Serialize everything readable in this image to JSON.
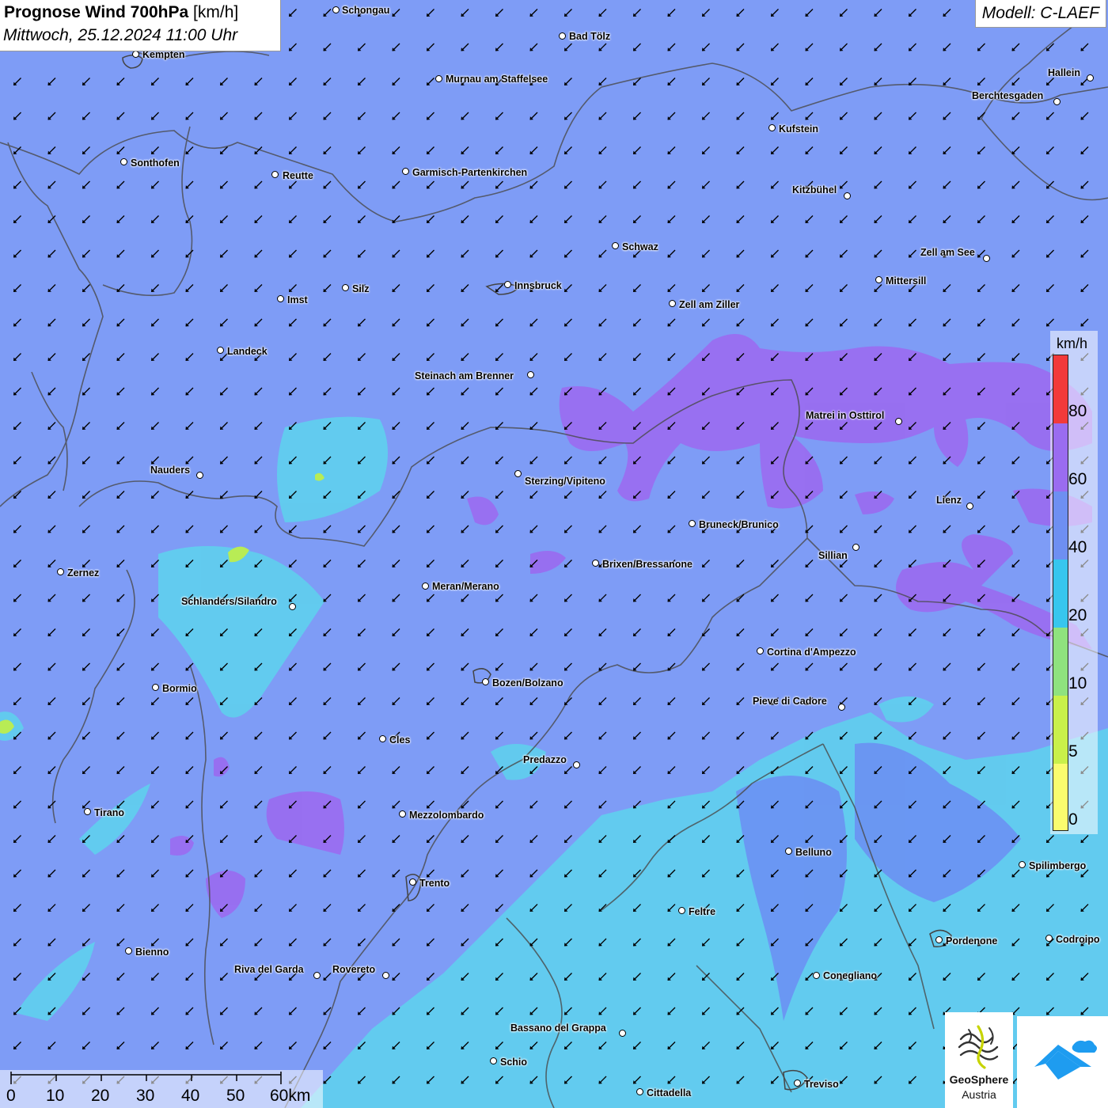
{
  "header": {
    "title": "Prognose Wind 700hPa",
    "title_unit": "[km/h]",
    "datetime": "Mittwoch, 25.12.2024 11:00 Uhr"
  },
  "model_label": "Modell: C-LAEF",
  "colors": {
    "background_wind": "#7e9cf6",
    "wind_20_40": "#5fd0ee",
    "wind_60_80": "#9a6cf0",
    "border_line": "#4a4a4a",
    "arrow_color": "#000000"
  },
  "wind_direction": "from northeast (arrows pointing southwest)",
  "cities": [
    {
      "name": "Schongau"
    },
    {
      "name": "Bad Tölz"
    },
    {
      "name": "Kempten"
    },
    {
      "name": "Murnau am Staffelsee"
    },
    {
      "name": "Hallein"
    },
    {
      "name": "Berchtesgaden"
    },
    {
      "name": "Kufstein"
    },
    {
      "name": "Sonthofen"
    },
    {
      "name": "Reutte"
    },
    {
      "name": "Garmisch-Partenkirchen"
    },
    {
      "name": "Kitzbühel"
    },
    {
      "name": "Schwaz"
    },
    {
      "name": "Zell am See"
    },
    {
      "name": "Mittersill"
    },
    {
      "name": "Innsbruck"
    },
    {
      "name": "Silz"
    },
    {
      "name": "Imst"
    },
    {
      "name": "Zell am Ziller"
    },
    {
      "name": "Landeck"
    },
    {
      "name": "Steinach am Brenner"
    },
    {
      "name": "Matrei in Osttirol"
    },
    {
      "name": "Nauders"
    },
    {
      "name": "Sterzing/Vipiteno"
    },
    {
      "name": "Lienz"
    },
    {
      "name": "Bruneck/Brunico"
    },
    {
      "name": "Sillian"
    },
    {
      "name": "Zernez"
    },
    {
      "name": "Brixen/Bressanone"
    },
    {
      "name": "Meran/Merano"
    },
    {
      "name": "Schlanders/Silandro"
    },
    {
      "name": "Cortina d'Ampezzo"
    },
    {
      "name": "Bozen/Bolzano"
    },
    {
      "name": "Bormio"
    },
    {
      "name": "Pieve di Cadore"
    },
    {
      "name": "Cles"
    },
    {
      "name": "Predazzo"
    },
    {
      "name": "Tirano"
    },
    {
      "name": "Mezzolombardo"
    },
    {
      "name": "Belluno"
    },
    {
      "name": "Spilimbergo"
    },
    {
      "name": "Trento"
    },
    {
      "name": "Feltre"
    },
    {
      "name": "Pordenone"
    },
    {
      "name": "Codroipo"
    },
    {
      "name": "Bienno"
    },
    {
      "name": "Riva del Garda"
    },
    {
      "name": "Rovereto"
    },
    {
      "name": "Conegliano"
    },
    {
      "name": "Bassano del Grappa"
    },
    {
      "name": "Schio"
    },
    {
      "name": "Treviso"
    },
    {
      "name": "Cittadella"
    }
  ],
  "legend": {
    "unit": "km/h",
    "ticks": [
      "80",
      "60",
      "40",
      "20",
      "10",
      "5",
      "0"
    ],
    "segments": [
      {
        "color": "#f23a3a"
      },
      {
        "color": "#9a6cf0"
      },
      {
        "color": "#6e8ff2"
      },
      {
        "color": "#37c6ee"
      },
      {
        "color": "#8fe27e"
      },
      {
        "color": "#c9f04a"
      },
      {
        "color": "#fafc6e"
      }
    ]
  },
  "scale_bar": {
    "labels": [
      "0",
      "10",
      "20",
      "30",
      "40",
      "50",
      "60km"
    ]
  },
  "logos": {
    "geosphere_line1": "GeoSphere",
    "geosphere_line2": "Austria"
  }
}
